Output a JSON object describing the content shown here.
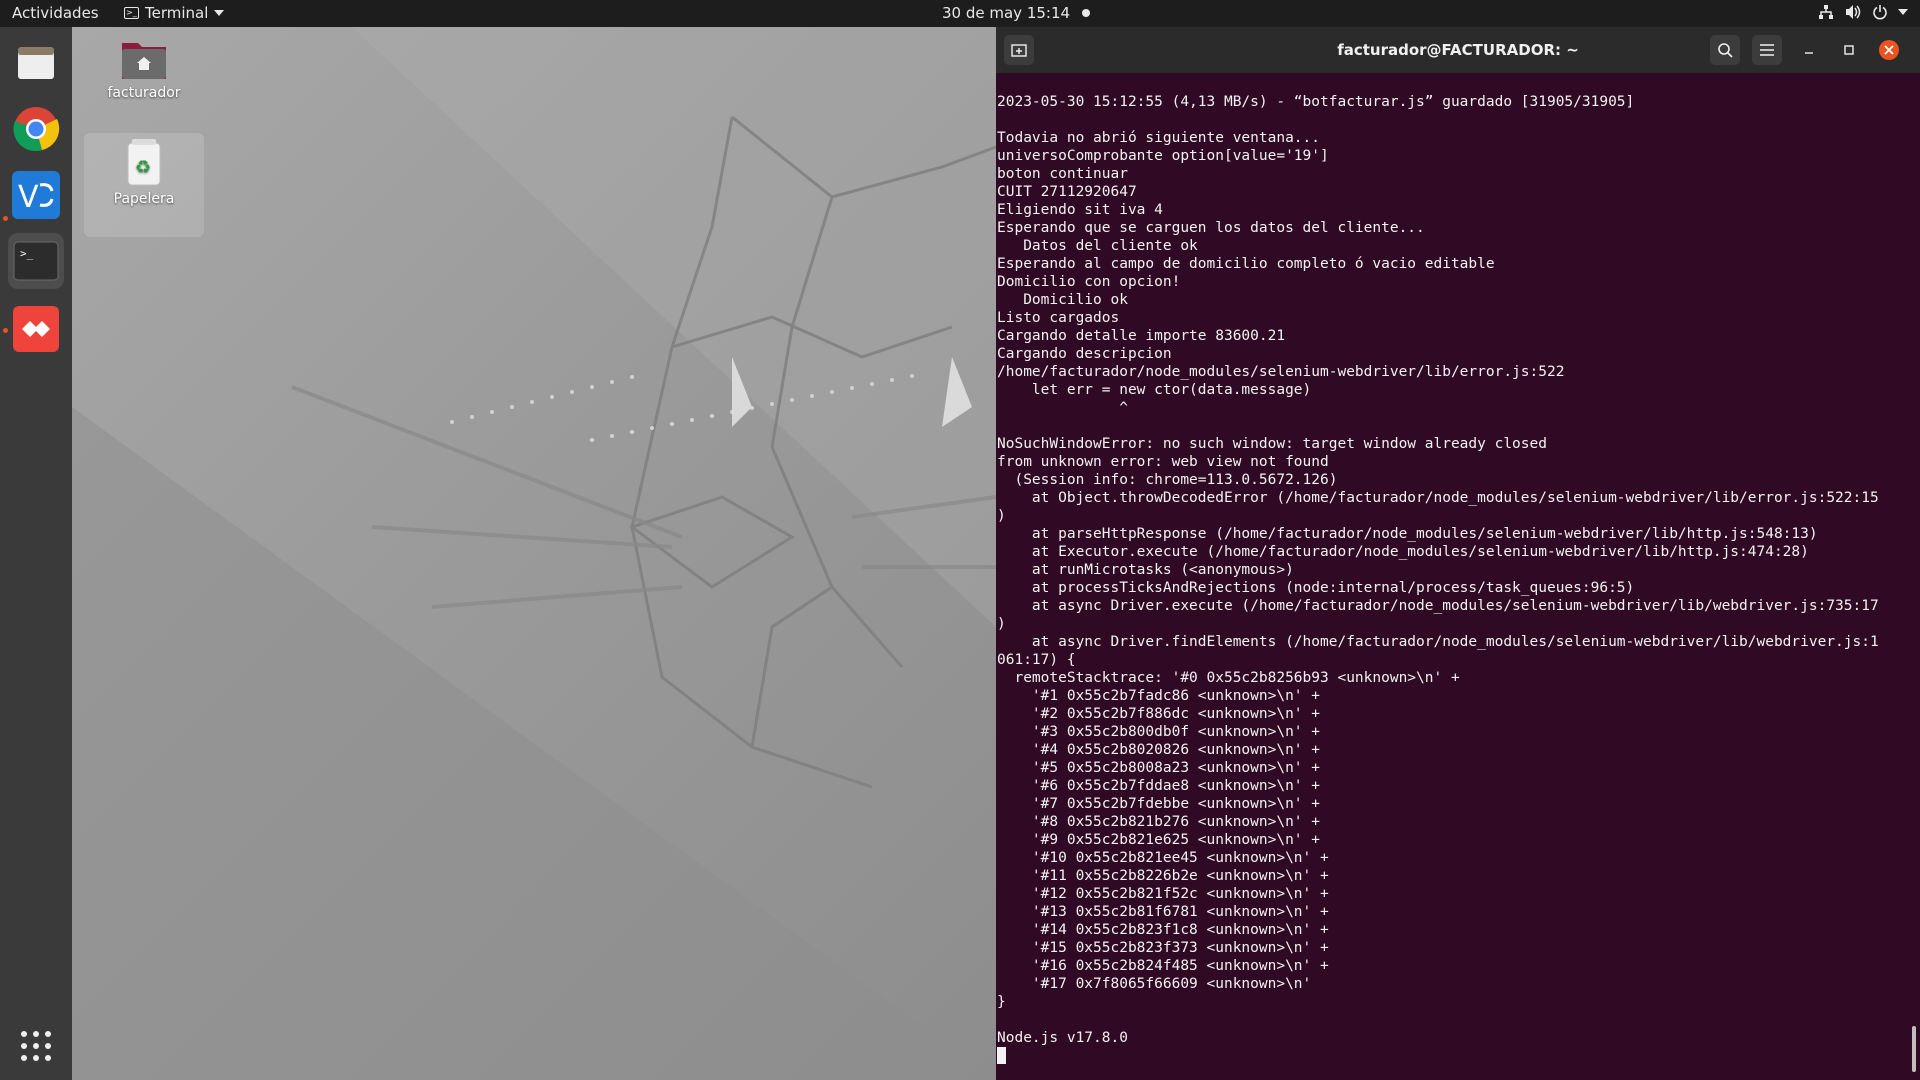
{
  "topbar": {
    "activities": "Actividades",
    "app_menu": "Terminal",
    "clock": "30 de may  15:14"
  },
  "dock": {
    "items": [
      "files",
      "chrome",
      "vscode",
      "terminal",
      "anydesk"
    ],
    "show_apps": "show-applications"
  },
  "desktop": {
    "icons": [
      {
        "label": "facturador"
      },
      {
        "label": "Papelera"
      }
    ]
  },
  "terminal": {
    "title": "facturador@FACTURADOR: ~",
    "lines": [
      "2023-05-30 15:12:55 (4,13 MB/s) - “botfacturar.js” guardado [31905/31905]",
      "",
      "Todavia no abrió siguiente ventana...",
      "universoComprobante option[value='19']",
      "boton continuar",
      "CUIT 27112920647",
      "Eligiendo sit iva 4",
      "Esperando que se carguen los datos del cliente...",
      "   Datos del cliente ok",
      "Esperando al campo de domicilio completo ó vacio editable",
      "Domicilio con opcion!",
      "   Domicilio ok",
      "Listo cargados",
      "Cargando detalle importe 83600.21",
      "Cargando descripcion",
      "/home/facturador/node_modules/selenium-webdriver/lib/error.js:522",
      "    let err = new ctor(data.message)",
      "              ^",
      "",
      "NoSuchWindowError: no such window: target window already closed",
      "from unknown error: web view not found",
      "  (Session info: chrome=113.0.5672.126)",
      "    at Object.throwDecodedError (/home/facturador/node_modules/selenium-webdriver/lib/error.js:522:15",
      ")",
      "    at parseHttpResponse (/home/facturador/node_modules/selenium-webdriver/lib/http.js:548:13)",
      "    at Executor.execute (/home/facturador/node_modules/selenium-webdriver/lib/http.js:474:28)",
      "    at runMicrotasks (<anonymous>)",
      "    at processTicksAndRejections (node:internal/process/task_queues:96:5)",
      "    at async Driver.execute (/home/facturador/node_modules/selenium-webdriver/lib/webdriver.js:735:17",
      ")",
      "    at async Driver.findElements (/home/facturador/node_modules/selenium-webdriver/lib/webdriver.js:1",
      "061:17) {",
      "  remoteStacktrace: '#0 0x55c2b8256b93 <unknown>\\n' +",
      "    '#1 0x55c2b7fadc86 <unknown>\\n' +",
      "    '#2 0x55c2b7f886dc <unknown>\\n' +",
      "    '#3 0x55c2b800db0f <unknown>\\n' +",
      "    '#4 0x55c2b8020826 <unknown>\\n' +",
      "    '#5 0x55c2b8008a23 <unknown>\\n' +",
      "    '#6 0x55c2b7fddae8 <unknown>\\n' +",
      "    '#7 0x55c2b7fdebbe <unknown>\\n' +",
      "    '#8 0x55c2b821b276 <unknown>\\n' +",
      "    '#9 0x55c2b821e625 <unknown>\\n' +",
      "    '#10 0x55c2b821ee45 <unknown>\\n' +",
      "    '#11 0x55c2b8226b2e <unknown>\\n' +",
      "    '#12 0x55c2b821f52c <unknown>\\n' +",
      "    '#13 0x55c2b81f6781 <unknown>\\n' +",
      "    '#14 0x55c2b823f1c8 <unknown>\\n' +",
      "    '#15 0x55c2b823f373 <unknown>\\n' +",
      "    '#16 0x55c2b824f485 <unknown>\\n' +",
      "    '#17 0x7f8065f66609 <unknown>\\n'",
      "}",
      "",
      "Node.js v17.8.0"
    ]
  }
}
